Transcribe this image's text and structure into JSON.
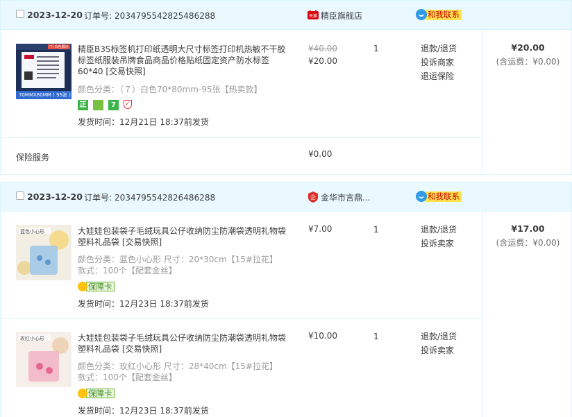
{
  "orders": [
    {
      "date": "2023-12-20",
      "order_no_label": "订单号:",
      "order_no": "2034795542825486288",
      "shop": "精臣旗舰店",
      "shop_icon": "tmall-icon",
      "contact_label": "和我联系",
      "items": [
        {
          "title": "精臣B3S标签机打印纸透明大尺寸标签打印机热敏不干胶标签纸服装吊牌食品商品价格贴纸固定资产防水标签60*40",
          "snapshot": "[交易快照]",
          "thumb_caption": "70MMX80MM ( 95张 )",
          "thumb_corner": "(7) 白色展示",
          "spec": "颜色分类：（７）白色70*80mm-95张【热卖款】",
          "badges": [
            "正",
            "保",
            "7",
            "盾"
          ],
          "ship": "发货时间：12月21日 18:37前发货",
          "price_old": "¥40.00",
          "price": "¥20.00",
          "qty": "1",
          "ops": [
            "退款/退货",
            "投诉商家",
            "退运保险"
          ]
        }
      ],
      "insurance_label": "保险服务",
      "insurance_amount": "¥0.00",
      "total": "¥20.00",
      "freight": "(含运费：¥0.00)"
    },
    {
      "date": "2023-12-20",
      "order_no_label": "订单号:",
      "order_no": "2034795542826486288",
      "shop": "金华市言鼎...",
      "shop_icon": "shop-badge-icon",
      "contact_label": "和我联系",
      "items": [
        {
          "title": "大娃娃包装袋子毛绒玩具公仔收纳防尘防潮袋透明礼物袋塑料礼品袋",
          "snapshot": "[交易快照]",
          "thumb_caption": "蓝色小心形",
          "spec": "颜色分类：蓝色小心形  尺寸：20*30cm【15#拉花】",
          "spec2": "款式：100个【配套金丝】",
          "card_label": "保障卡",
          "ship": "发货时间：12月23日 18:37前发货",
          "price": "¥7.00",
          "qty": "1",
          "ops": [
            "退款/退货",
            "投诉卖家"
          ]
        },
        {
          "title": "大娃娃包装袋子毛绒玩具公仔收纳防尘防潮袋透明礼物袋塑料礼品袋",
          "snapshot": "[交易快照]",
          "thumb_caption": "玫红小心形",
          "spec": "颜色分类：玫红小心形  尺寸：28*40cm【15#拉花】",
          "spec2": "款式：100个【配套金丝】",
          "card_label": "保障卡",
          "ship": "发货时间：12月23日 18:37前发货",
          "price": "¥10.00",
          "qty": "1",
          "ops": [
            "退款/退货",
            "投诉卖家"
          ]
        }
      ],
      "total": "¥17.00",
      "freight": "(含运费：¥0.00)"
    }
  ],
  "colors": {
    "header_bg": "#eaf8ff",
    "border": "#daf3ff",
    "contact_bg": "#ffe34d",
    "contact_text": "#c40000"
  }
}
